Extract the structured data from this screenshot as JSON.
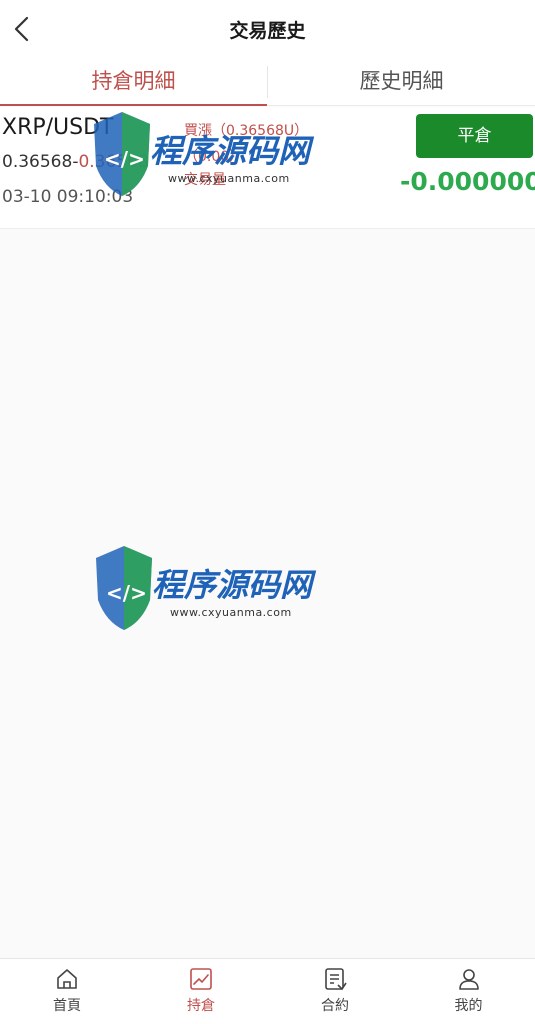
{
  "header": {
    "title": "交易歷史"
  },
  "tabs": [
    {
      "label": "持倉明細",
      "active": true
    },
    {
      "label": "歷史明細",
      "active": false
    }
  ],
  "positions": [
    {
      "symbol": "XRP/USDT",
      "direction": "買漲（0.36568U）",
      "price_open": "0.36568",
      "price_sep": "-",
      "price_current": "0.36568",
      "sub_label": "（0.00）",
      "sub_label2": "交易量",
      "open_time": "03-10 09:10:03",
      "close_label": "平倉",
      "pnl": "-0.000000"
    }
  ],
  "watermark": {
    "text": "程序源码网",
    "url": "www.cxyuanma.com"
  },
  "bottom_nav": [
    {
      "label": "首頁",
      "icon": "home-icon",
      "active": false
    },
    {
      "label": "持倉",
      "icon": "chart-icon",
      "active": true
    },
    {
      "label": "合約",
      "icon": "contract-icon",
      "active": false
    },
    {
      "label": "我的",
      "icon": "user-icon",
      "active": false
    }
  ],
  "colors": {
    "accent": "#c0504d",
    "buy_green": "#1a8a2a",
    "pnl_green": "#2daa4d",
    "watermark_blue": "#1f63b8"
  }
}
